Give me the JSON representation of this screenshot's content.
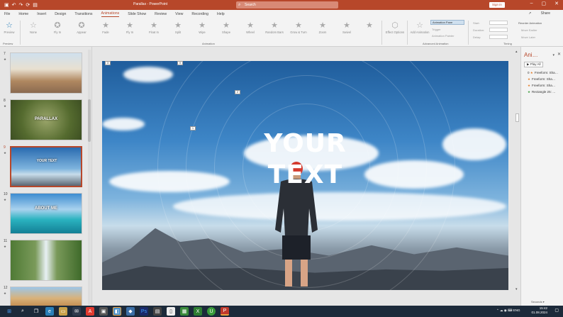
{
  "titlebar": {
    "doc": "Parallax",
    "app": "PowerPoint",
    "sep": " - ",
    "search_placeholder": "Search",
    "signin": "Sign in",
    "qat": [
      "▣",
      "↶",
      "↷",
      "⟳",
      "▤"
    ]
  },
  "tabs": [
    "File",
    "Home",
    "Insert",
    "Design",
    "Transitions",
    "Animations",
    "Slide Show",
    "Review",
    "View",
    "Recording",
    "Help"
  ],
  "active_tab": "Animations",
  "share": "Share",
  "ribbon": {
    "preview": "Preview",
    "animations": [
      "None",
      "Fly In",
      "Appear",
      "Fade",
      "Fly In",
      "Float In",
      "Split",
      "Wipe",
      "Shape",
      "Wheel",
      "Random Bars",
      "Grow & Turn",
      "Zoom",
      "Swivel"
    ],
    "effect_options": "Effect Options",
    "add_animation": "Add Animation",
    "animation_pane": "Animation Pane",
    "trigger": "Trigger",
    "animation_painter": "Animation Painter",
    "start": "Start:",
    "duration": "Duration:",
    "delay": "Delay:",
    "reorder": "Reorder Animation",
    "move_earlier": "Move Earlier",
    "move_later": "Move Later",
    "groups": {
      "preview": "Preview",
      "animation": "Animation",
      "advanced": "Advanced Animation",
      "timing": "Timing"
    }
  },
  "slides": [
    {
      "num": "7",
      "star": "★",
      "text": ""
    },
    {
      "num": "8",
      "star": "★",
      "text": "PARALLAX"
    },
    {
      "num": "9",
      "star": "★",
      "text": "YOUR TEXT"
    },
    {
      "num": "10",
      "star": "★",
      "text": "ABOUT ME"
    },
    {
      "num": "11",
      "star": "★",
      "text": ""
    },
    {
      "num": "12",
      "star": "★",
      "text": ""
    }
  ],
  "slide": {
    "line1": "YOUR",
    "line2": "TEXT",
    "tags": [
      "3",
      "0",
      "2",
      "1"
    ]
  },
  "anim_pane": {
    "title": "Ani…",
    "play_all": "Play All",
    "items": [
      {
        "label": "Freeform: Sha…",
        "num": "0",
        "icon": "star-orange"
      },
      {
        "label": "Freeform: Sha…",
        "num": "",
        "icon": "star-orange"
      },
      {
        "label": "Freeform: Sha…",
        "num": "",
        "icon": "star-orange"
      },
      {
        "label": "Rectangle 25: …",
        "num": "",
        "icon": "star-green"
      }
    ],
    "seconds": "Seconds ▾"
  },
  "tray": {
    "lang": "ENG",
    "time": "15:42",
    "date": "01.08.2024"
  },
  "colors": {
    "accent": "#b7472a",
    "taskbar": "#1c2a3a"
  }
}
